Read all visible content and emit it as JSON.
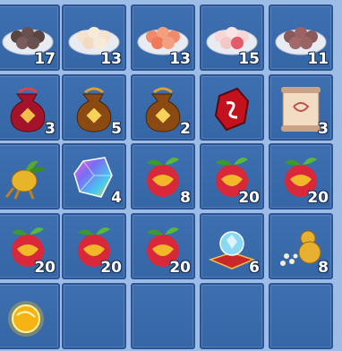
{
  "inventory": {
    "slots": [
      {
        "item": "plate-of-dumplings-icon",
        "count": "17"
      },
      {
        "item": "plate-of-dumplings-icon",
        "count": "13"
      },
      {
        "item": "plate-of-dumplings-icon",
        "count": "13"
      },
      {
        "item": "plate-of-dumplings-icon",
        "count": "15"
      },
      {
        "item": "plate-of-dumplings-icon",
        "count": "11"
      },
      {
        "item": "red-pouch-icon",
        "count": "3"
      },
      {
        "item": "gold-pouch-icon",
        "count": "5"
      },
      {
        "item": "gold-pouch-icon",
        "count": "2"
      },
      {
        "item": "red-rune-stone-icon",
        "count": ""
      },
      {
        "item": "scroll-icon",
        "count": "3"
      },
      {
        "item": "golden-root-icon",
        "count": ""
      },
      {
        "item": "rainbow-crystal-icon",
        "count": "4"
      },
      {
        "item": "magic-fruit-icon",
        "count": "8"
      },
      {
        "item": "magic-fruit-icon",
        "count": "20"
      },
      {
        "item": "magic-fruit-icon",
        "count": "20"
      },
      {
        "item": "magic-fruit-icon",
        "count": "20"
      },
      {
        "item": "magic-fruit-icon",
        "count": "20"
      },
      {
        "item": "magic-fruit-icon",
        "count": "20"
      },
      {
        "item": "crystal-on-cushion-icon",
        "count": "6"
      },
      {
        "item": "gourd-and-pearls-icon",
        "count": "8"
      },
      {
        "item": "golden-orb-icon",
        "count": ""
      },
      {
        "item": "empty-slot",
        "count": ""
      },
      {
        "item": "empty-slot",
        "count": ""
      },
      {
        "item": "empty-slot",
        "count": ""
      },
      {
        "item": "empty-slot",
        "count": ""
      }
    ]
  }
}
